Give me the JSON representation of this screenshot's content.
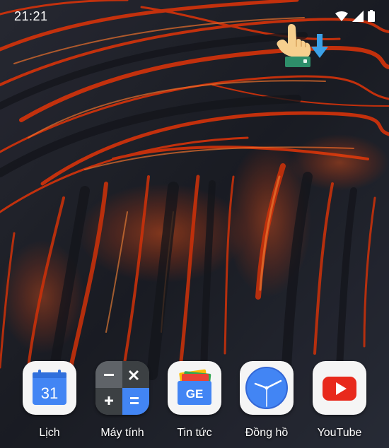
{
  "status_bar": {
    "time": "21:21",
    "icons": [
      "wifi-icon",
      "cellular-signal-icon",
      "battery-icon"
    ]
  },
  "gesture_hint": {
    "icons": [
      "pointing-hand-icon",
      "down-arrow-icon"
    ]
  },
  "dock": {
    "apps": [
      {
        "label": "Lịch",
        "icon": "calendar-icon",
        "icon_text": "31"
      },
      {
        "label": "Máy tính",
        "icon": "calculator-icon"
      },
      {
        "label": "Tin tức",
        "icon": "news-icon",
        "icon_text": "GE"
      },
      {
        "label": "Đồng hồ",
        "icon": "clock-icon"
      },
      {
        "label": "YouTube",
        "icon": "youtube-icon"
      }
    ]
  },
  "colors": {
    "lava_glow": "#ff4a10",
    "rock_dark": "#1e2027",
    "calendar_blue": "#4285f4",
    "youtube_red": "#e8291c",
    "hint_arrow": "#3ba1e8"
  }
}
